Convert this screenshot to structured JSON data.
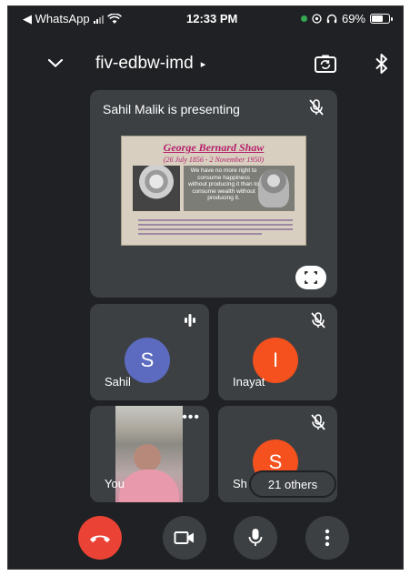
{
  "status_bar": {
    "back_app": "◀ WhatsApp",
    "time": "12:33 PM",
    "battery_percent": "69%",
    "battery_level": 0.69
  },
  "header": {
    "meeting_code": "fiv-edbw-imd",
    "caret": "▸"
  },
  "presentation": {
    "label": "Sahil Malik is presenting",
    "slide_title": "George Bernard Shaw",
    "slide_dates": "(26 July 1856 - 2 November 1950)",
    "slide_quote": "We have no more right to consume happiness without producing it than to consume wealth without producing it."
  },
  "participants": [
    {
      "name": "Sahil",
      "initial": "S",
      "avatar_color": "#5c6bc0",
      "mic": "speaking"
    },
    {
      "name": "Inayat",
      "initial": "I",
      "avatar_color": "#f4511e",
      "mic": "muted"
    },
    {
      "name": "You",
      "video": true,
      "mic": "on"
    },
    {
      "name": "Sh",
      "initial": "S",
      "avatar_color": "#f4511e",
      "mic": "muted"
    }
  ],
  "others_label": "21 others",
  "controls": {
    "end_call_color": "#ea4335",
    "button_color": "#3c4043"
  },
  "colors": {
    "background": "#202124",
    "tile": "#3c4043"
  }
}
